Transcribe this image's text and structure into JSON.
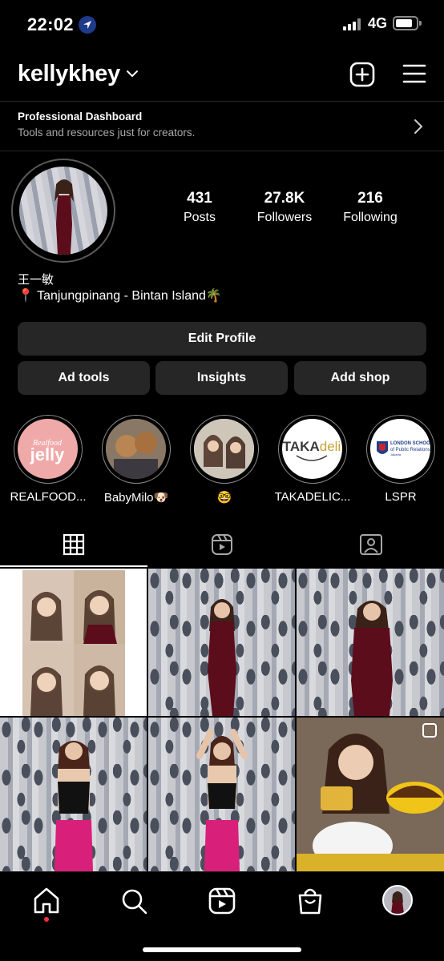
{
  "status_bar": {
    "time": "22:02",
    "network": "4G",
    "battery_fraction": 0.85
  },
  "header": {
    "username": "kellykhey"
  },
  "dashboard": {
    "title": "Professional Dashboard",
    "subtitle": "Tools and resources just for creators."
  },
  "profile": {
    "stats": [
      {
        "value": "431",
        "label": "Posts"
      },
      {
        "value": "27.8K",
        "label": "Followers"
      },
      {
        "value": "216",
        "label": "Following"
      }
    ],
    "name": "王一敏",
    "bio": "📍 Tanjungpinang - Bintan Island🌴"
  },
  "buttons": {
    "edit_profile": "Edit Profile",
    "ad_tools": "Ad tools",
    "insights": "Insights",
    "add_shop": "Add shop"
  },
  "highlights": [
    {
      "label": "REALFOOD...",
      "cover_text": "Realfood jelly"
    },
    {
      "label": "BabyMilo🐶"
    },
    {
      "label": "🤓"
    },
    {
      "label": "TAKADELIC...",
      "cover_text": "TAKAdeli"
    },
    {
      "label": "LSPR",
      "cover_text": "LONDON SCHOOL of Public Relations"
    }
  ],
  "tabs": [
    "grid",
    "reels",
    "tagged"
  ],
  "bottom_nav": [
    "home",
    "search",
    "reels",
    "shop",
    "profile"
  ],
  "colors": {
    "background": "#000000",
    "button_bg": "#262626",
    "secondary_text": "#a8a8a8",
    "notification_dot": "#ff3040"
  }
}
